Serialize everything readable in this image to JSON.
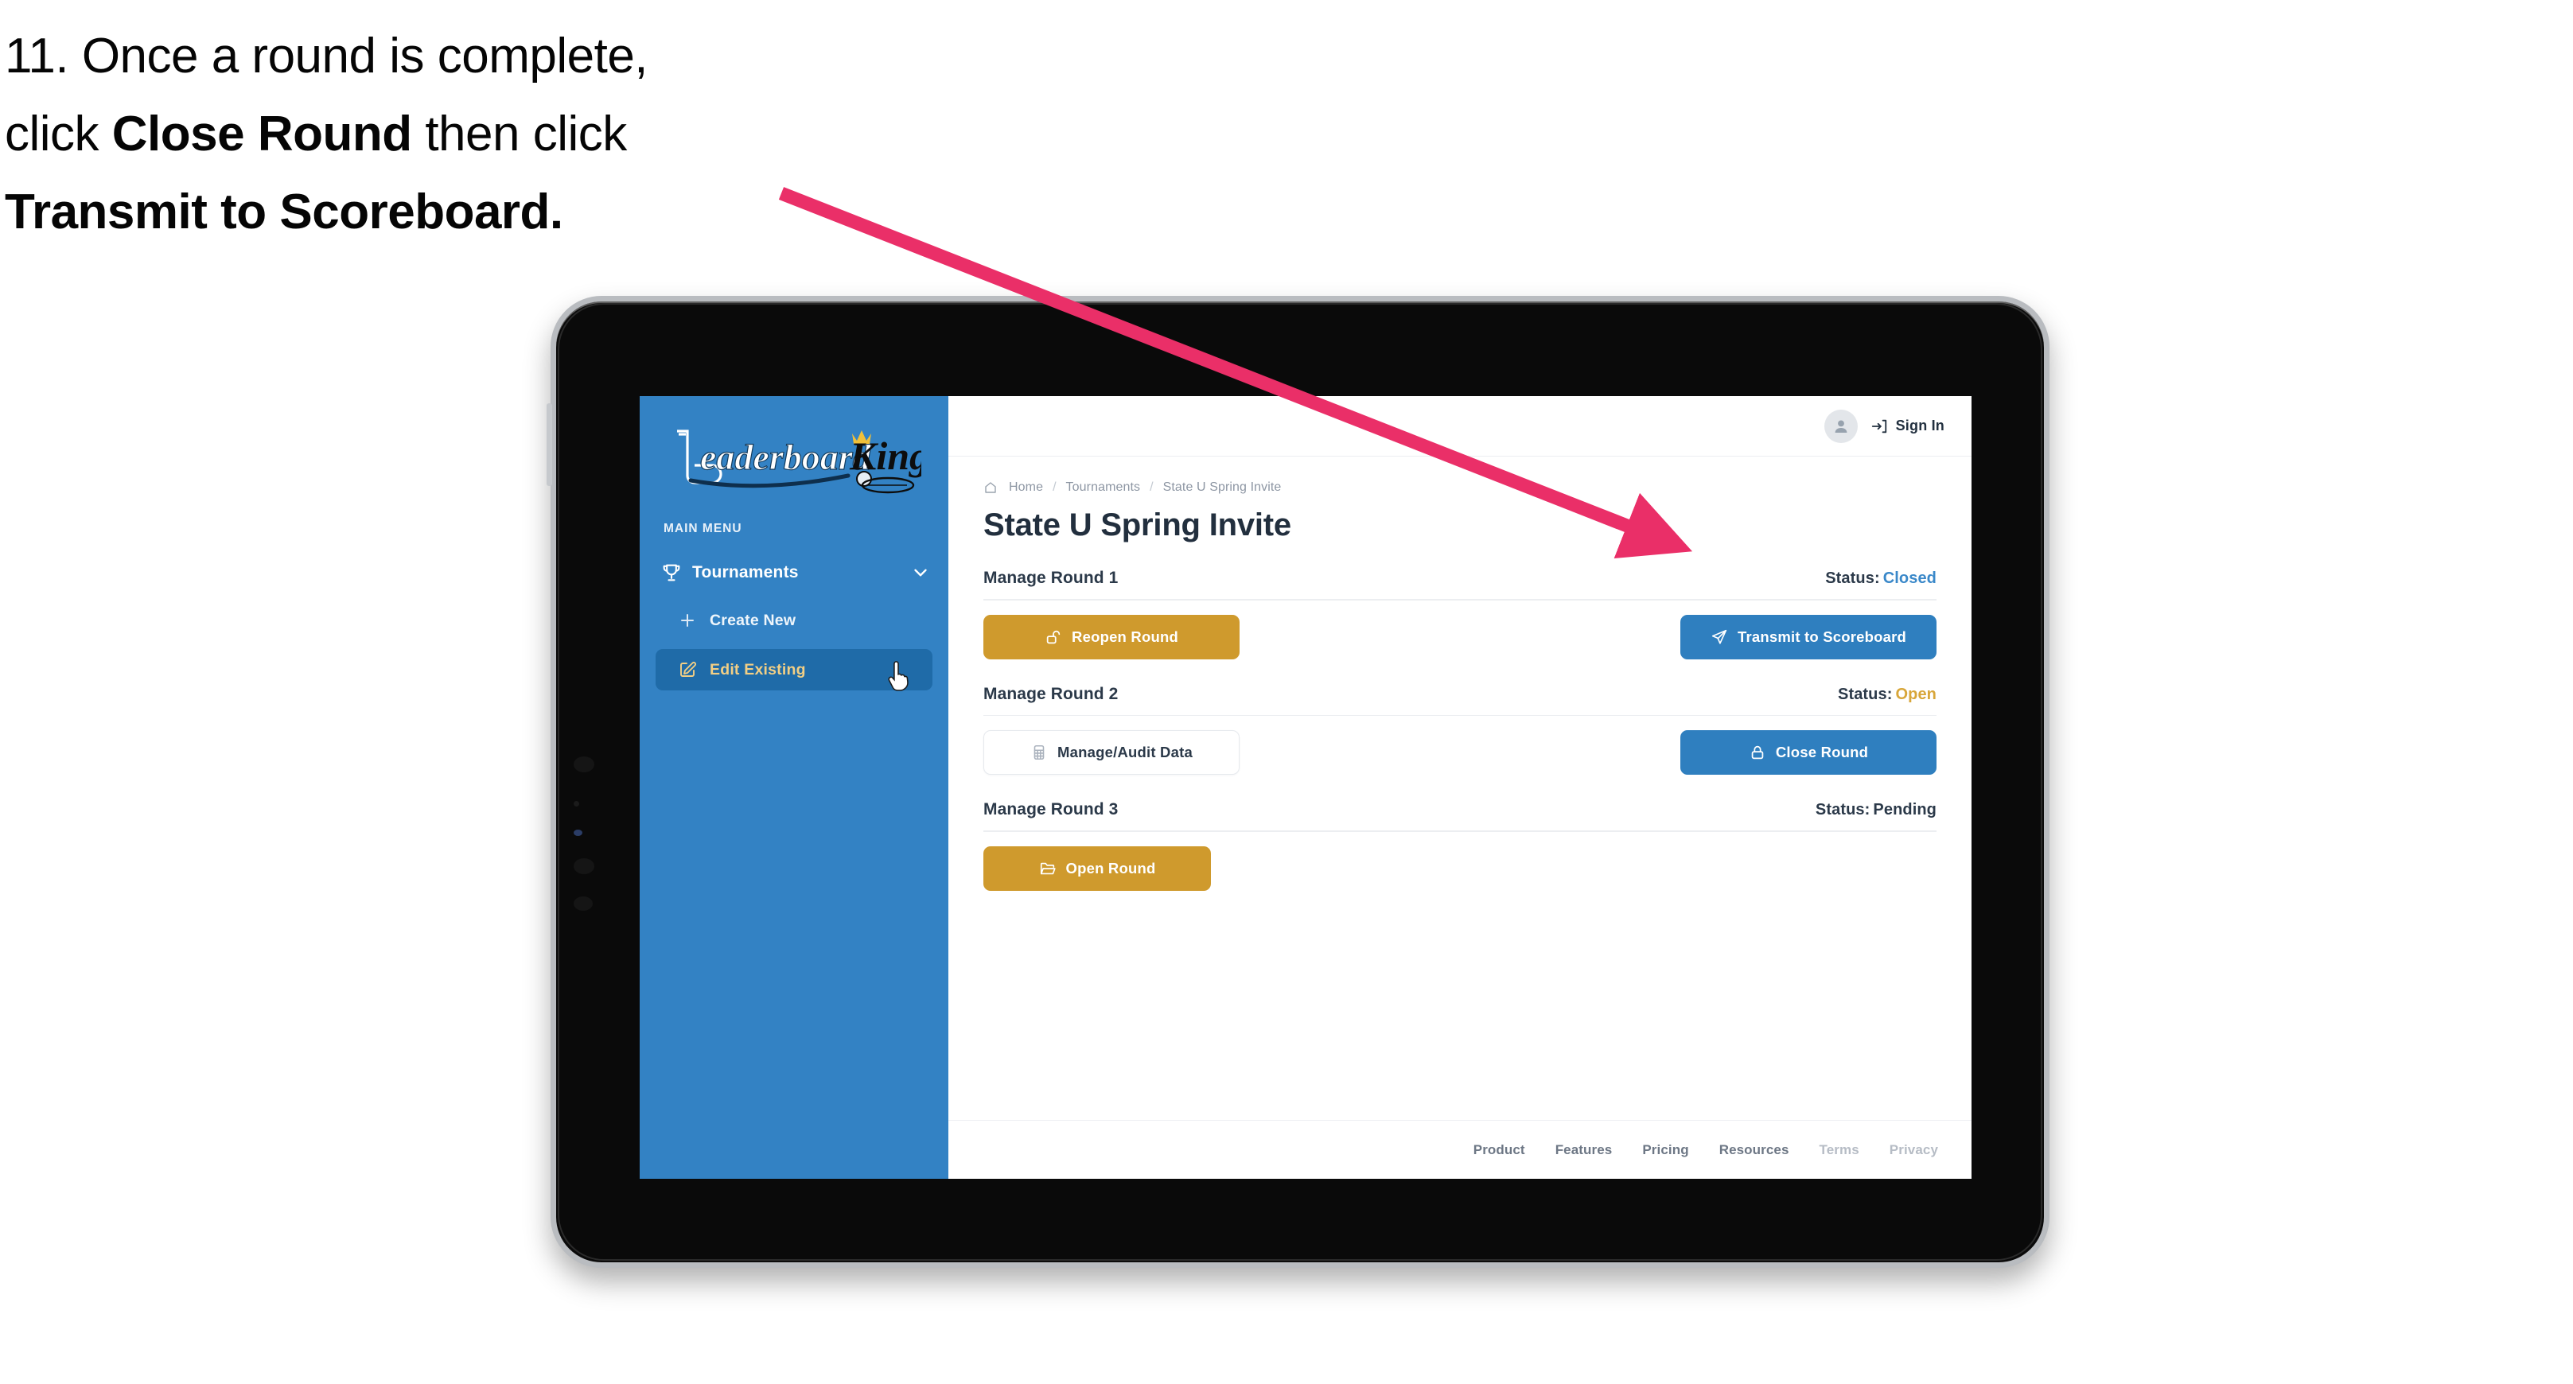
{
  "caption": {
    "line1_prefix": "11. Once a round is complete,",
    "line2_pre": "click ",
    "line2_bold": "Close Round",
    "line2_post": " then click",
    "line3_bold": "Transmit to Scoreboard."
  },
  "annotation": {
    "arrow_color": "#ea2f68",
    "points_to": "Transmit to Scoreboard"
  },
  "device": {
    "type": "tablet",
    "bezel_color": "#0a0a0a",
    "frame_color": "#b9bcc0"
  },
  "app": {
    "sidebar": {
      "logo": {
        "word1": "Leaderboard",
        "word2": "King"
      },
      "section_label": "MAIN MENU",
      "nav": {
        "group_label": "Tournaments",
        "group_icon": "trophy-icon",
        "chevron_icon": "chevron-down-icon",
        "items": [
          {
            "label": "Create New",
            "icon": "plus-icon",
            "active": false
          },
          {
            "label": "Edit Existing",
            "icon": "edit-square-icon",
            "active": true
          }
        ]
      },
      "bg_color": "#3382c4",
      "active_bg_color": "#1f6ba8",
      "active_text_color": "#f2cf85"
    },
    "topbar": {
      "avatar_icon": "user-avatar-icon",
      "signin_icon": "login-arrow-icon",
      "signin_label": "Sign In"
    },
    "breadcrumb": {
      "home_icon": "home-icon",
      "items": [
        "Home",
        "Tournaments",
        "State U Spring Invite"
      ],
      "separator": "/"
    },
    "page_title": "State U Spring Invite",
    "rounds": [
      {
        "title": "Manage Round 1",
        "status_label": "Status:",
        "status_value": "Closed",
        "status_class": "closed",
        "left_button": {
          "label": "Reopen Round",
          "icon": "unlock-icon",
          "style": "gold"
        },
        "right_button": {
          "label": "Transmit to Scoreboard",
          "icon": "paper-plane-icon",
          "style": "blue"
        }
      },
      {
        "title": "Manage Round 2",
        "status_label": "Status:",
        "status_value": "Open",
        "status_class": "open",
        "left_button": {
          "label": "Manage/Audit Data",
          "icon": "table-grid-icon",
          "style": "ghost"
        },
        "right_button": {
          "label": "Close Round",
          "icon": "lock-icon",
          "style": "blue"
        }
      },
      {
        "title": "Manage Round 3",
        "status_label": "Status:",
        "status_value": "Pending",
        "status_class": "pending",
        "left_button": {
          "label": "Open Round",
          "icon": "folder-open-icon",
          "style": "gold"
        },
        "right_button": null
      }
    ],
    "footer": {
      "links": [
        {
          "label": "Product",
          "muted": false
        },
        {
          "label": "Features",
          "muted": false
        },
        {
          "label": "Pricing",
          "muted": false
        },
        {
          "label": "Resources",
          "muted": false
        },
        {
          "label": "Terms",
          "muted": true
        },
        {
          "label": "Privacy",
          "muted": true
        }
      ]
    },
    "colors": {
      "gold": "#cf9a2d",
      "blue": "#2f7fbf",
      "status_closed": "#3a88c9",
      "status_open": "#d8a63a",
      "text_dark": "#2b3949"
    }
  }
}
